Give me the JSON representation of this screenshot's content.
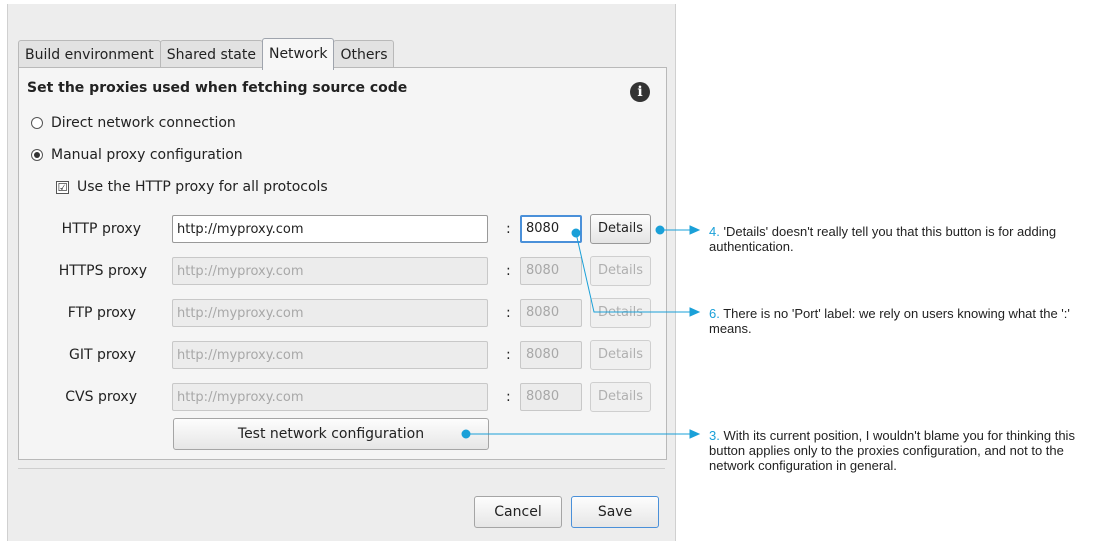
{
  "tabs": [
    "Build environment",
    "Shared state",
    "Network",
    "Others"
  ],
  "heading": "Set the proxies used when fetching source code",
  "info_icon": "info-icon",
  "radio_direct": "Direct network connection",
  "radio_manual": "Manual proxy configuration",
  "checkbox_http_all": "Use the HTTP proxy for all protocols",
  "checkbox_mark": "☑",
  "proxies": [
    {
      "label": "HTTP proxy",
      "url": "http://myproxy.com",
      "port": "8080",
      "details": "Details",
      "enabled": true
    },
    {
      "label": "HTTPS proxy",
      "url": "http://myproxy.com",
      "port": "8080",
      "details": "Details",
      "enabled": false
    },
    {
      "label": "FTP proxy",
      "url": "http://myproxy.com",
      "port": "8080",
      "details": "Details",
      "enabled": false
    },
    {
      "label": "GIT proxy",
      "url": "http://myproxy.com",
      "port": "8080",
      "details": "Details",
      "enabled": false
    },
    {
      "label": "CVS proxy",
      "url": "http://myproxy.com",
      "port": "8080",
      "details": "Details",
      "enabled": false
    }
  ],
  "colon": ":",
  "test_button": "Test network configuration",
  "cancel_button": "Cancel",
  "save_button": "Save",
  "annotations": [
    {
      "num": "4.",
      "text": "'Details' doesn't really tell you that this button is for adding authentication."
    },
    {
      "num": "6.",
      "text": "There is no 'Port' label: we rely on users knowing what the ':' means."
    },
    {
      "num": "3.",
      "text": "With its current position, I wouldn't blame you for thinking this button applies only to the proxies configuration, and not to the network configuration in general."
    }
  ],
  "accent_color": "#1aa0d8"
}
